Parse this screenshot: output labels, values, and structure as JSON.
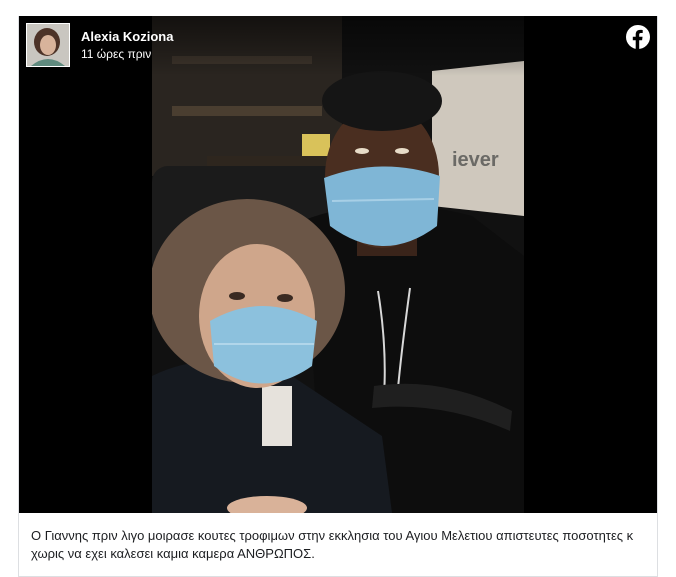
{
  "post": {
    "author_name": "Alexia Koziona",
    "timestamp": "11 ώρες πριν",
    "caption": "Ο Γιαννης πριν λιγο μοιρασε κουτες τροφιμων στην εκκλησια του Αγιου Μελετιου απιστευτες ποσοτητες κ χωρις να εχει καλεσει καμια καμερα ΑΝΘΡΩΠΟΣ.",
    "platform_icon": "facebook-icon"
  },
  "colors": {
    "media_background": "#000000",
    "text": "#1c1e21",
    "facebook_logo": "#ffffff",
    "border": "#dddfe2"
  }
}
